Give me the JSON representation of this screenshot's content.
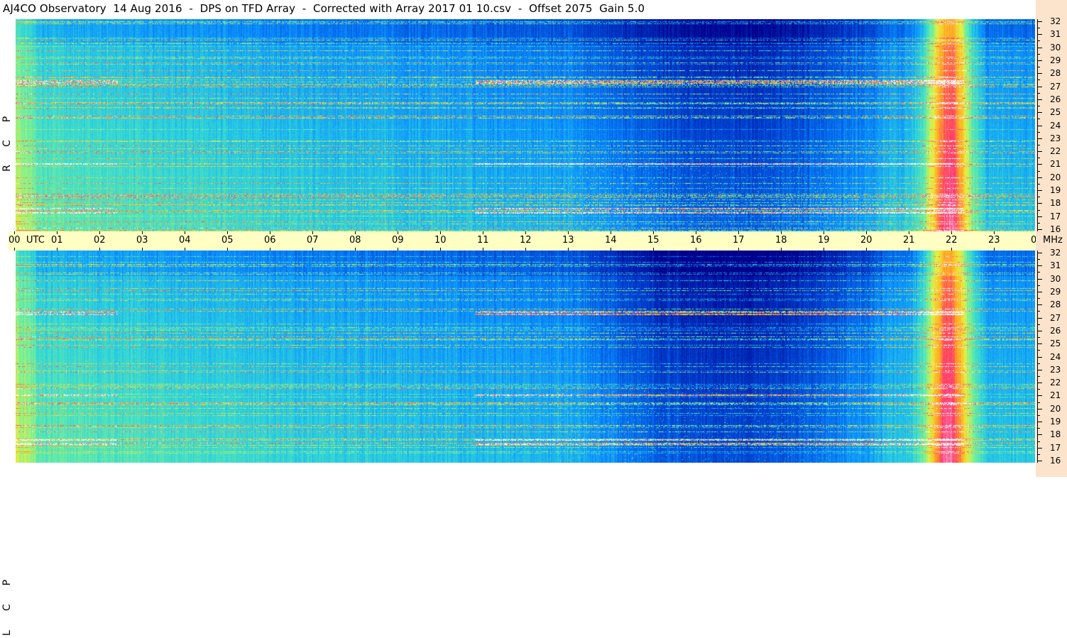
{
  "title": "AJ4CO Observatory  14 Aug 2016  -  DPS on TFD Array  -  Corrected with Array 2017 01 10.csv  -  Offset 2075  Gain 5.0",
  "panels": [
    {
      "name": "rcp",
      "label_letters": [
        "R",
        "C",
        "P"
      ]
    },
    {
      "name": "lcp",
      "label_letters": [
        "L",
        "C",
        "P"
      ]
    }
  ],
  "time_axis": {
    "unit_label": "UTC",
    "hour_labels": [
      "00",
      "01",
      "02",
      "03",
      "04",
      "05",
      "06",
      "07",
      "08",
      "09",
      "10",
      "11",
      "12",
      "13",
      "14",
      "15",
      "16",
      "17",
      "18",
      "19",
      "20",
      "21",
      "22",
      "23",
      "00"
    ]
  },
  "frequency_axis": {
    "unit_label": "MHz",
    "tick_labels": [
      "32",
      "31",
      "30",
      "29",
      "28",
      "27",
      "26",
      "25",
      "24",
      "23",
      "22",
      "21",
      "20",
      "19",
      "18",
      "17",
      "16"
    ]
  },
  "colors": {
    "timebar_background": "#ffffc4",
    "right_scale_background": "#fce4cc",
    "colormap": [
      "#00008a",
      "#0040d0",
      "#0a8cff",
      "#2ad0e0",
      "#6cf0a0",
      "#e8f040",
      "#ffb020",
      "#ff3070",
      "#ffffff"
    ]
  }
}
